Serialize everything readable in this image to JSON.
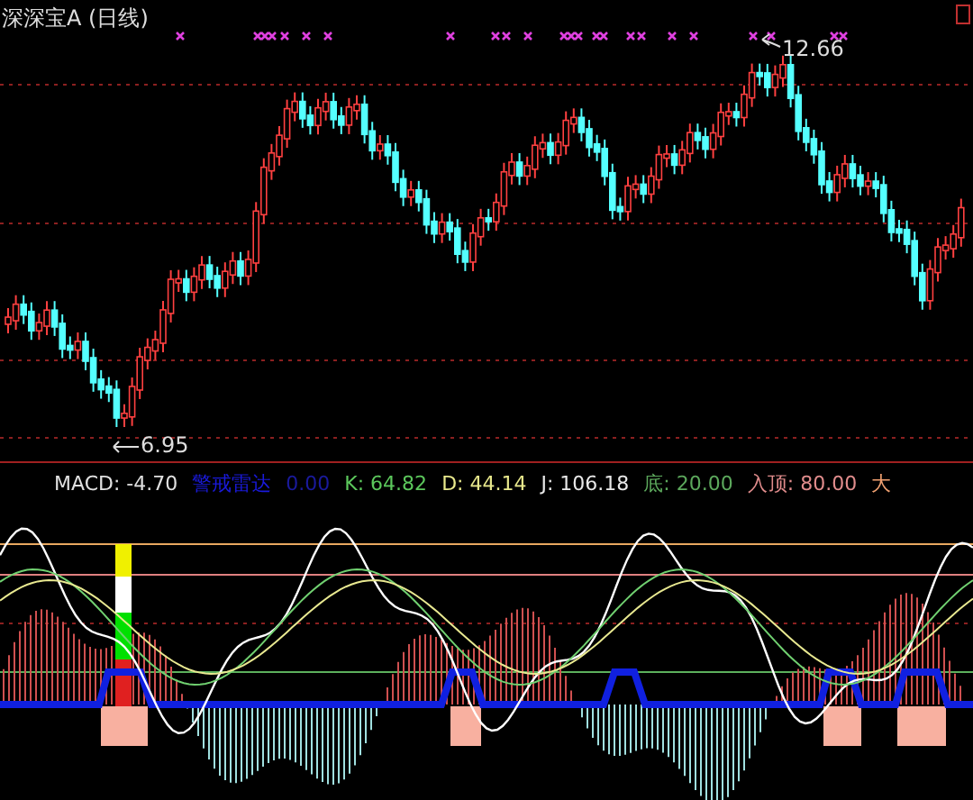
{
  "chart": {
    "title": "深深宝A (日线)",
    "high_label": "12.66",
    "low_label": "6.95"
  },
  "indicator_bar": [
    {
      "text": "MACD: -4.70",
      "color": "#e0e0e0"
    },
    {
      "text": "警戒雷达",
      "color": "#1a1adc"
    },
    {
      "text": "0.00",
      "color": "#1a1a9c"
    },
    {
      "text": "K: 64.82",
      "color": "#5cc85c"
    },
    {
      "text": "D: 44.14",
      "color": "#e8e88c"
    },
    {
      "text": "J: 106.18",
      "color": "#e8e8e8"
    },
    {
      "text": "底: 20.00",
      "color": "#5ca85c"
    },
    {
      "text": "入顶: 80.00",
      "color": "#e08c8c"
    },
    {
      "text": "大",
      "color": "#f0a070"
    }
  ]
}
